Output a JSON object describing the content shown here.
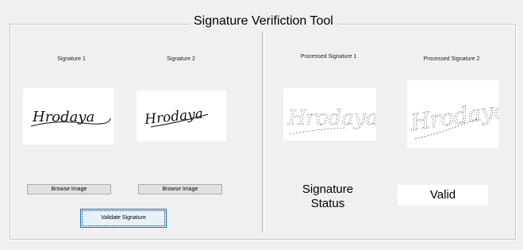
{
  "window": {
    "title": "Signature Verifiction Tool"
  },
  "left": {
    "signature1": {
      "label": "Signature 1",
      "image_text": "Hrodaya"
    },
    "signature2": {
      "label": "Signature 2",
      "image_text": "Hrodaya"
    },
    "browse1_label": "Browse Image",
    "browse2_label": "Browse Image",
    "validate_label": "Validate Signature"
  },
  "right": {
    "processed1": {
      "label": "Processed Signature 1",
      "image_text": "Hrodaya"
    },
    "processed2": {
      "label": "Processed Signature 2",
      "image_text": "Hrodaya"
    },
    "status_label": "Signature Status",
    "status_value": "Valid"
  }
}
